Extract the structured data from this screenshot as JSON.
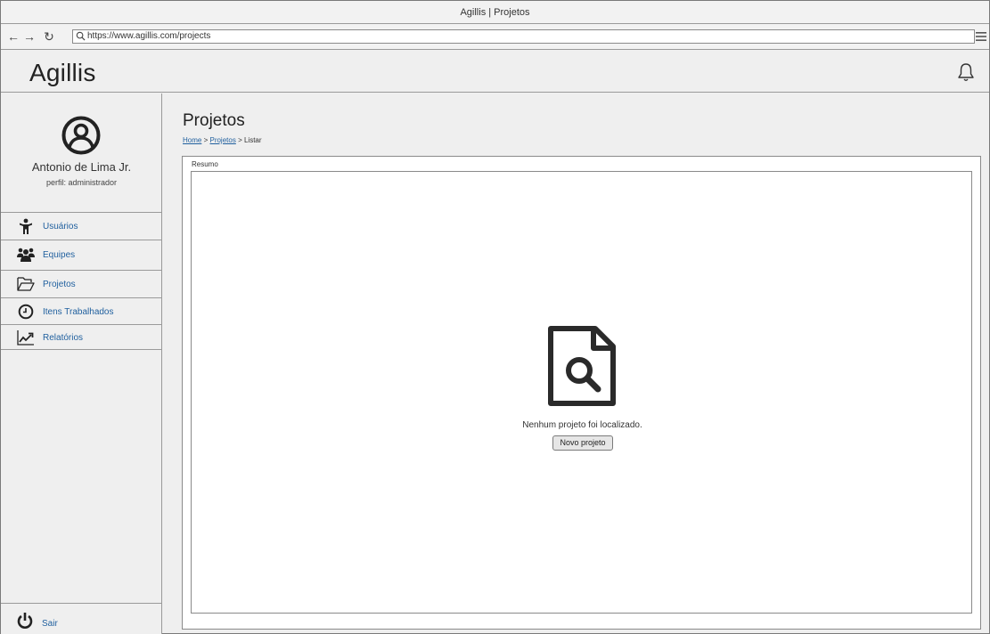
{
  "window": {
    "title": "Agillis | Projetos"
  },
  "browser": {
    "url": "https://www.agillis.com/projects"
  },
  "header": {
    "brand": "Agillis",
    "notification_icon": "bell-icon"
  },
  "user": {
    "name": "Antonio de Lima Jr.",
    "role": "perfil: administrador"
  },
  "sidebar": {
    "items": [
      {
        "label": "Usuários",
        "icon": "user-icon"
      },
      {
        "label": "Equipes",
        "icon": "team-icon"
      },
      {
        "label": "Projetos",
        "icon": "folder-icon"
      },
      {
        "label": "Itens Trabalhados",
        "icon": "clock-icon"
      },
      {
        "label": "Relatórios",
        "icon": "chart-icon"
      }
    ],
    "logout_label": "Sair"
  },
  "main": {
    "title": "Projetos",
    "breadcrumb": {
      "home": "Home",
      "sep1": ">",
      "projects": "Projetos",
      "sep2": ">",
      "current": "Listar"
    },
    "panel_label": "Resumo",
    "empty_message": "Nenhum projeto foi localizado.",
    "new_button": "Novo projeto"
  },
  "colors": {
    "link": "#1f5f9e",
    "background": "#efefef",
    "border": "#9a9a9a"
  }
}
